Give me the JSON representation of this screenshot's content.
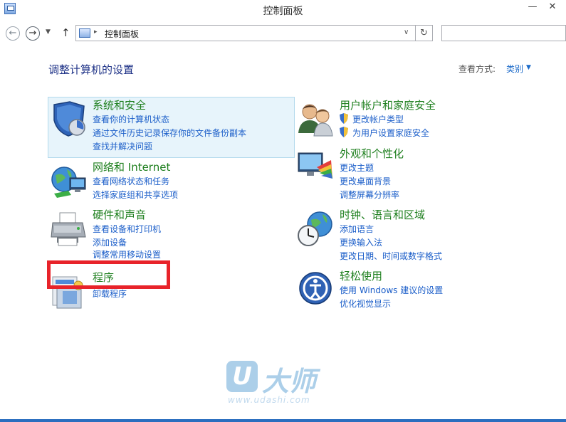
{
  "window": {
    "title": "控制面板",
    "minimize_glyph": "—",
    "close_glyph": "✕"
  },
  "navigation": {
    "back_glyph": "←",
    "forward_glyph": "→",
    "dropdown_glyph": "▼",
    "up_glyph": "↑",
    "address_path": "控制面板",
    "address_separator": "▸",
    "address_dropdown_glyph": "∨",
    "refresh_glyph": "↻",
    "search_placeholder": ""
  },
  "header": {
    "title": "调整计算机的设置",
    "view_by_label": "查看方式:",
    "view_by_value": "类别",
    "view_by_arrow": "▼"
  },
  "categories": [
    {
      "heading": "系统和安全",
      "icon": "system-security-shield-icon",
      "links": [
        "查看你的计算机状态",
        "通过文件历史记录保存你的文件备份副本",
        "查找并解决问题"
      ]
    },
    {
      "heading": "网络和 Internet",
      "icon": "network-globe-icon",
      "links": [
        "查看网络状态和任务",
        "选择家庭组和共享选项"
      ]
    },
    {
      "heading": "硬件和声音",
      "icon": "printer-hardware-icon",
      "links": [
        "查看设备和打印机",
        "添加设备",
        "调整常用移动设置"
      ]
    },
    {
      "heading": "程序",
      "icon": "programs-icon",
      "links": [
        "卸载程序"
      ]
    },
    {
      "heading": "用户帐户和家庭安全",
      "icon": "users-icon",
      "links": [
        "更改帐户类型",
        "为用户设置家庭安全"
      ]
    },
    {
      "heading": "外观和个性化",
      "icon": "appearance-monitor-icon",
      "links": [
        "更改主题",
        "更改桌面背景",
        "调整屏幕分辨率"
      ]
    },
    {
      "heading": "时钟、语言和区域",
      "icon": "clock-globe-icon",
      "links": [
        "添加语言",
        "更换输入法",
        "更改日期、时间或数字格式"
      ]
    },
    {
      "heading": "轻松使用",
      "icon": "ease-of-access-icon",
      "links": [
        "使用 Windows 建议的设置",
        "优化视觉显示"
      ]
    }
  ],
  "watermark": {
    "logo_letter": "U",
    "brand": "大师",
    "url": "www.udashi.com"
  },
  "colors": {
    "heading_green": "#1e7f1e",
    "link_blue": "#1b5ec9",
    "highlight_bg": "#e7f4fb",
    "annotation_red": "#e8232a"
  }
}
